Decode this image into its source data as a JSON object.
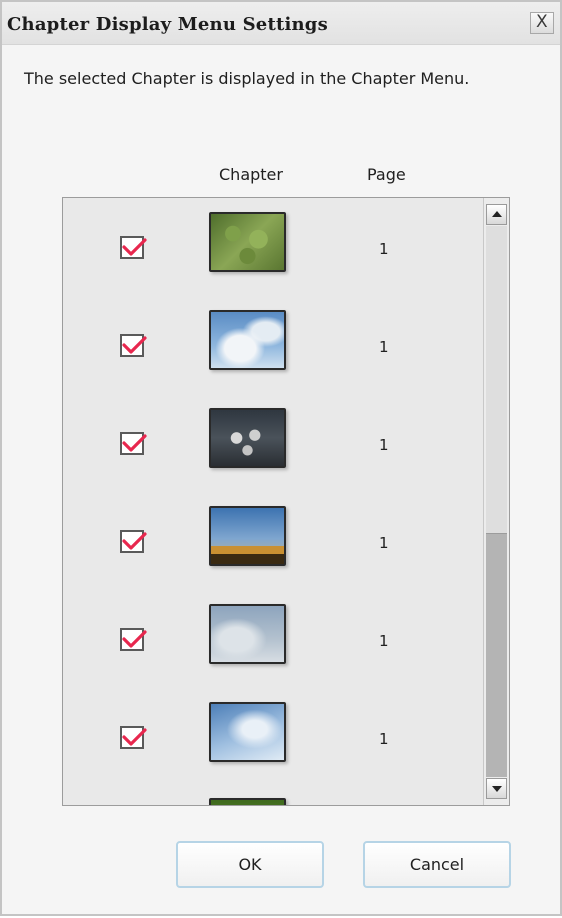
{
  "window": {
    "title": "Chapter Display Menu Settings",
    "close_label": "X"
  },
  "description": "The selected Chapter is displayed in the Chapter Menu.",
  "table": {
    "columns": [
      "Chapter",
      "Page"
    ],
    "rows": [
      {
        "checked": true,
        "thumbnail": "greenery-photo",
        "page": "1"
      },
      {
        "checked": true,
        "thumbnail": "sky-clouds-photo",
        "page": "1"
      },
      {
        "checked": true,
        "thumbnail": "cafe-tables-photo",
        "page": "1"
      },
      {
        "checked": true,
        "thumbnail": "city-sunset-photo",
        "page": "1"
      },
      {
        "checked": true,
        "thumbnail": "hazy-sky-photo",
        "page": "1"
      },
      {
        "checked": true,
        "thumbnail": "wispy-clouds-photo",
        "page": "1"
      },
      {
        "checked": false,
        "thumbnail": "green-photo-partial",
        "page": ""
      }
    ]
  },
  "buttons": {
    "ok": "OK",
    "cancel": "Cancel"
  },
  "colors": {
    "checkmark": "#e8274e",
    "button_border": "#b6d4e6"
  }
}
